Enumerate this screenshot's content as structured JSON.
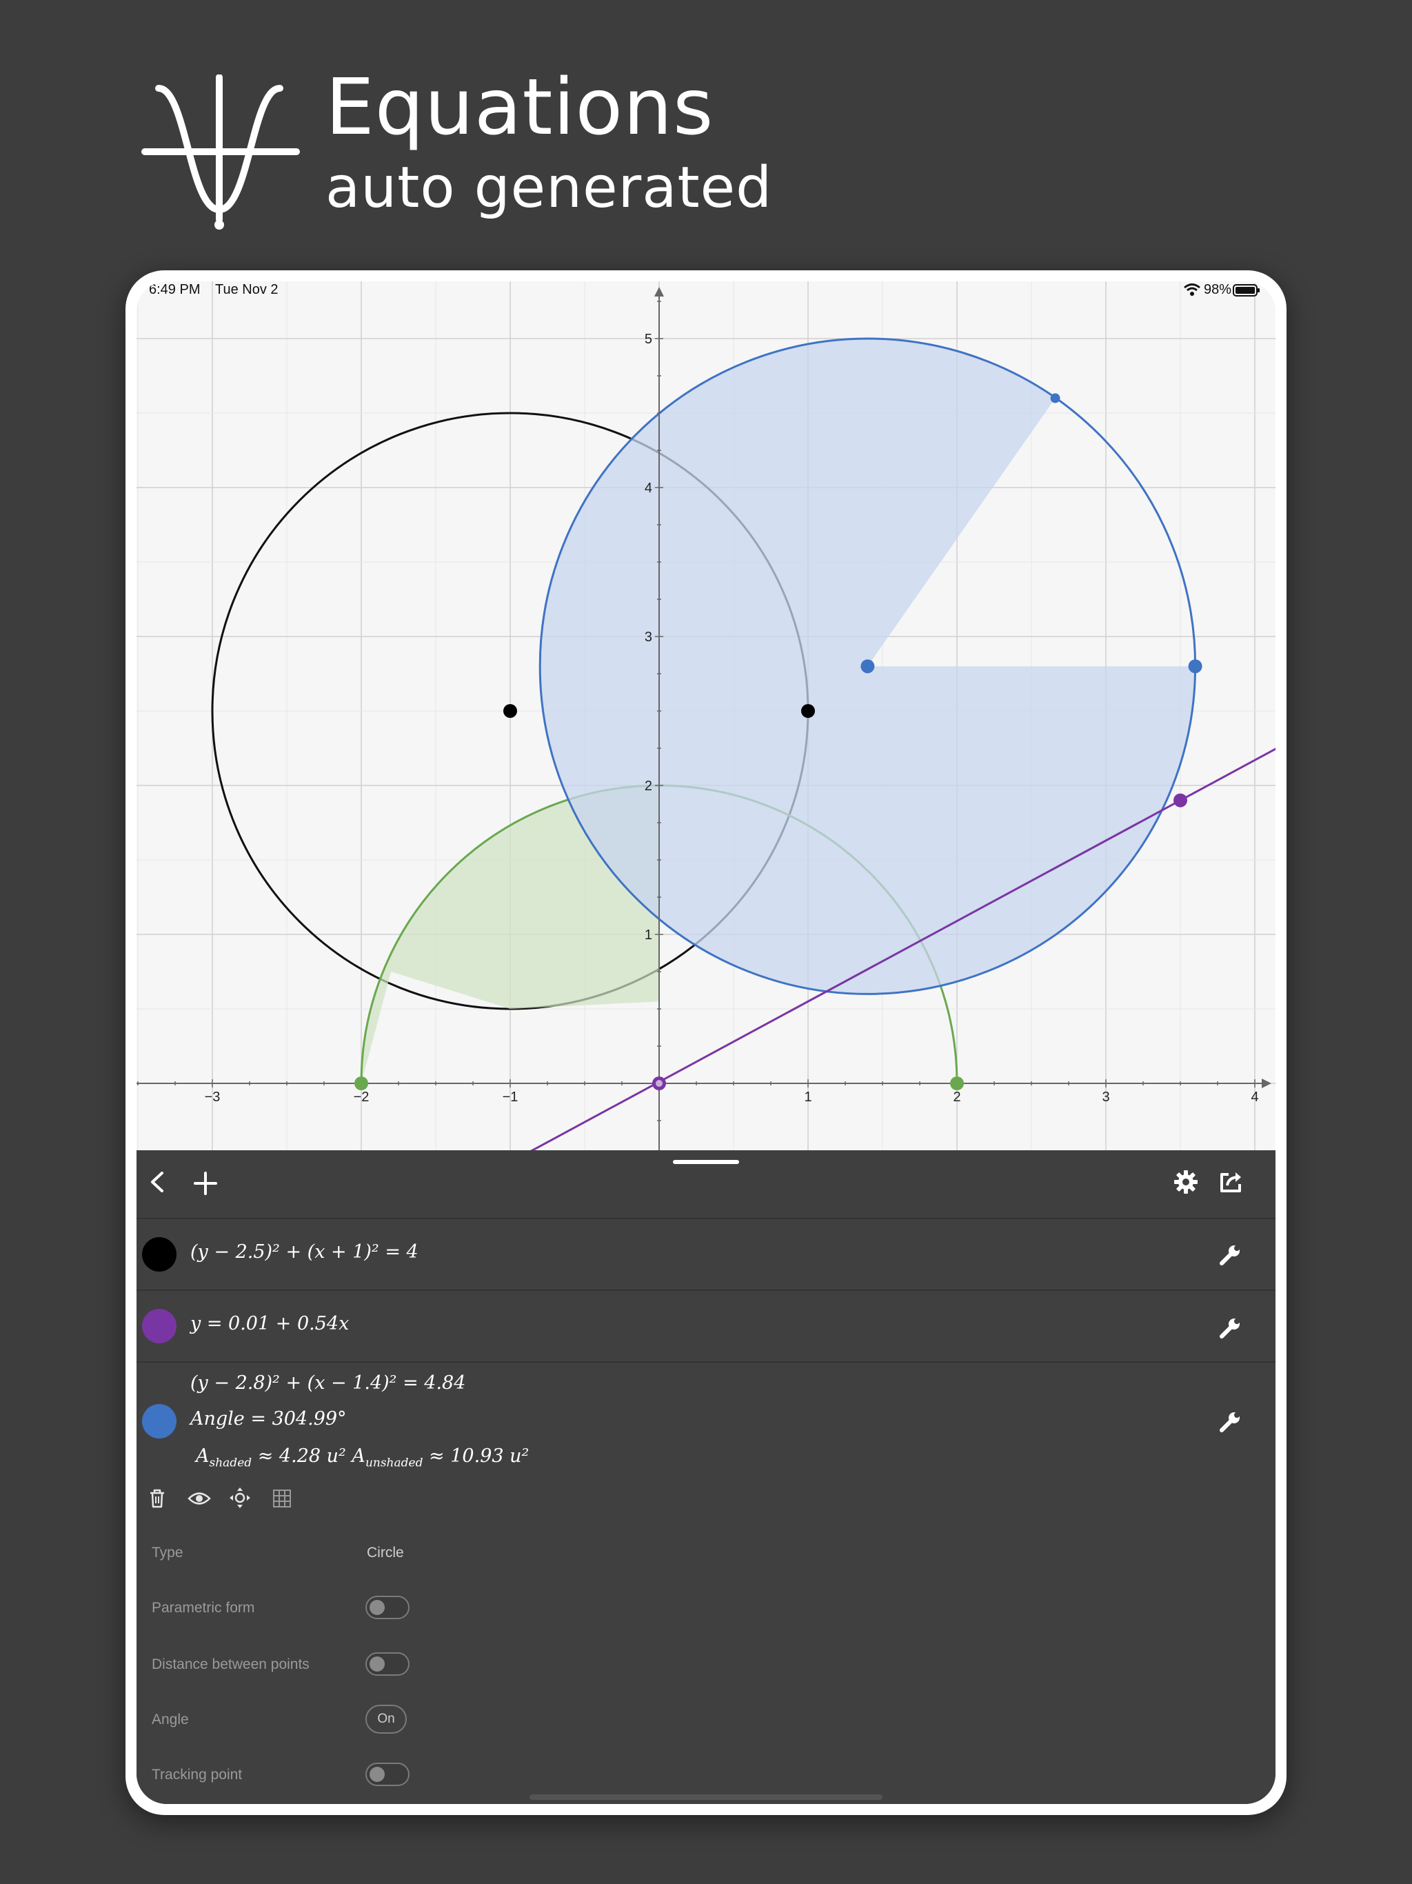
{
  "promo": {
    "title": "Equations",
    "subtitle": "auto generated"
  },
  "status_bar": {
    "time": "6:49 PM",
    "date": "Tue Nov 2",
    "battery": "98%"
  },
  "chart_data": {
    "type": "scatter",
    "x_tick_labels": [
      "−3",
      "−2",
      "−1",
      "1",
      "2",
      "3",
      "4"
    ],
    "y_tick_labels": [
      "1",
      "2",
      "3",
      "4",
      "5"
    ],
    "xlim": [
      -3.5,
      4.1
    ],
    "ylim": [
      -0.45,
      5.4
    ],
    "grid": true,
    "x_ticks": [
      -3,
      -2,
      -1,
      1,
      2,
      3,
      4
    ],
    "y_ticks": [
      1,
      2,
      3,
      4,
      5
    ],
    "shapes": [
      {
        "kind": "circle",
        "cx": -1,
        "cy": 2.5,
        "r": 2,
        "color": "#111111",
        "fill": "none"
      },
      {
        "kind": "semicircle",
        "cx": 0,
        "cy": 0,
        "r": 2,
        "color": "#6aa84f",
        "fill": "#cfe3c3"
      },
      {
        "kind": "circle",
        "cx": 1.4,
        "cy": 2.8,
        "r": 2.2,
        "color": "#3f73c4",
        "fill": "#c7d6ee",
        "shaded_sector_angle": 304.99
      },
      {
        "kind": "line",
        "intercept": 0.01,
        "slope": 0.54,
        "color": "#7a35a4"
      }
    ],
    "points": [
      {
        "x": -1,
        "y": 2.5,
        "color": "#000000"
      },
      {
        "x": 1,
        "y": 2.5,
        "color": "#000000"
      },
      {
        "x": 1.4,
        "y": 2.8,
        "color": "#3f73c4"
      },
      {
        "x": 3.6,
        "y": 2.8,
        "color": "#3f73c4"
      },
      {
        "x": 2.66,
        "y": 4.6,
        "color": "#3f73c4"
      },
      {
        "x": -2,
        "y": 0,
        "color": "#6aa84f"
      },
      {
        "x": 2,
        "y": 0,
        "color": "#6aa84f"
      },
      {
        "x": 0,
        "y": 0,
        "color": "#7a35a4"
      },
      {
        "x": 3.5,
        "y": 1.9,
        "color": "#7a35a4"
      }
    ]
  },
  "equations": [
    {
      "color": "#000000",
      "lines": [
        "(y − 2.5)² + (x + 1)² = 4"
      ]
    },
    {
      "color": "#7a35a4",
      "lines": [
        "y = 0.01 + 0.54x"
      ]
    },
    {
      "color": "#3f73c4",
      "lines": [
        "(y − 2.8)² + (x − 1.4)² = 4.84",
        "Angle = 304.99°",
        "A_shaded ≈ 4.28 u² A_unshaded ≈ 10.93 u²"
      ]
    }
  ],
  "properties": {
    "type_label": "Type",
    "type_value": "Circle",
    "parametric_label": "Parametric form",
    "distance_label": "Distance between points",
    "angle_label": "Angle",
    "angle_value": "On",
    "tracking_label": "Tracking point"
  },
  "icons": {
    "back": "chevron-left-icon",
    "add": "plus-icon",
    "settings": "gear-icon",
    "share": "share-icon",
    "edit": "wrench-icon",
    "delete": "trash-icon",
    "visibility": "eye-icon",
    "move": "move-icon",
    "table": "grid-icon"
  }
}
